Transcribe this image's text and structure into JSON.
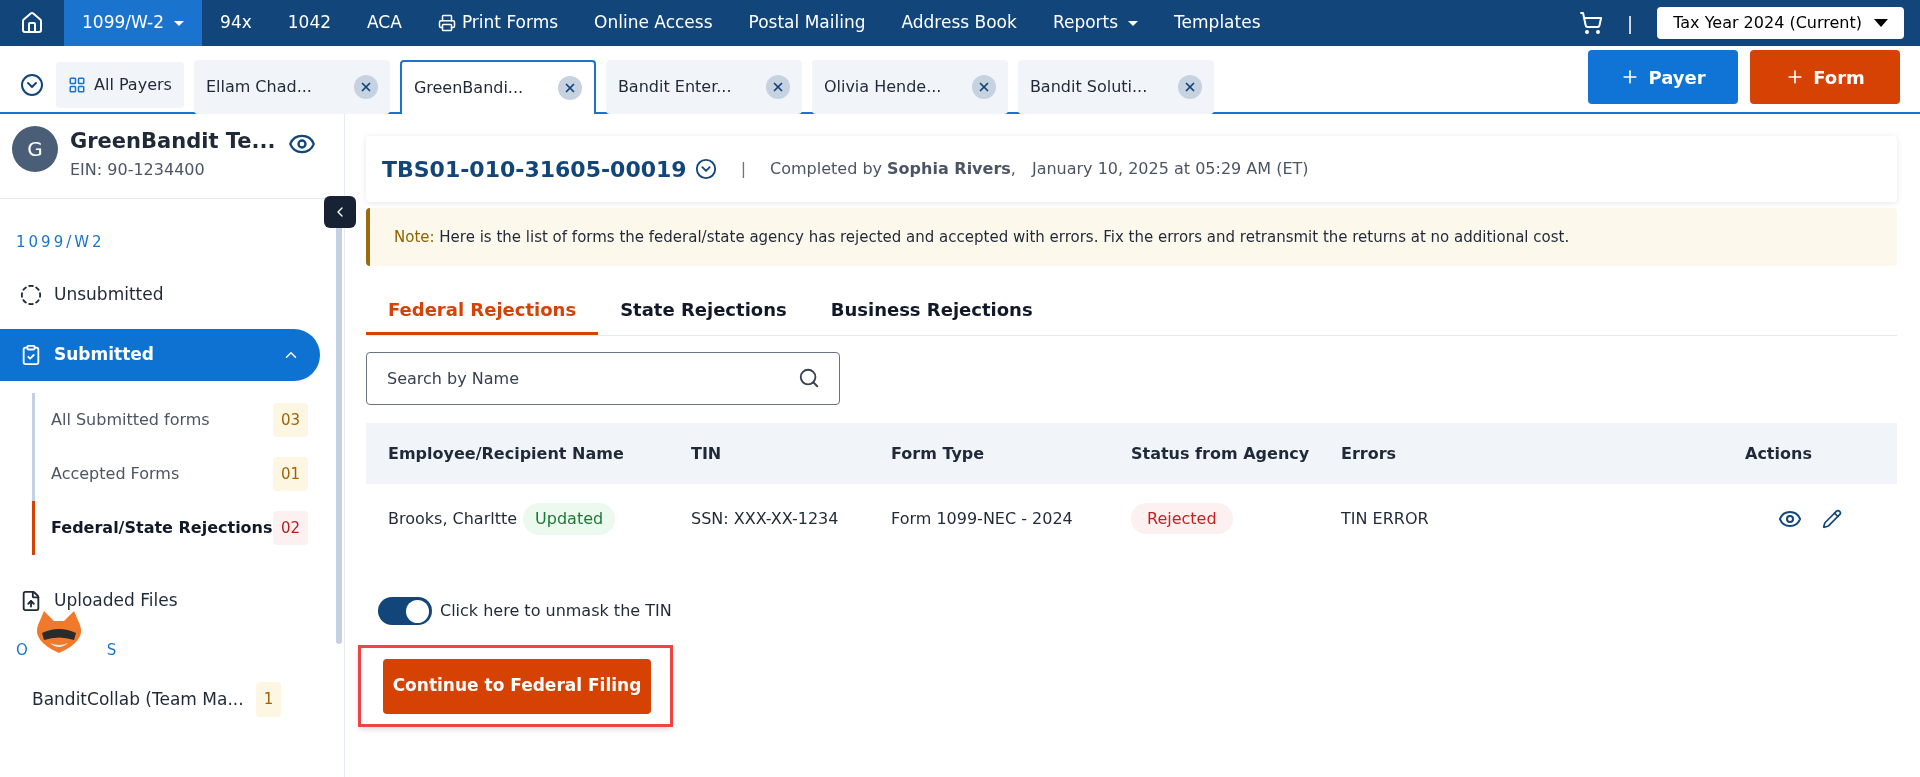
{
  "top_nav": [
    {
      "label": "1099/W-2",
      "selected": true,
      "kind": "dropdown"
    },
    {
      "label": "94x",
      "selected": false,
      "kind": "link"
    },
    {
      "label": "1042",
      "selected": false,
      "kind": "link"
    },
    {
      "label": "ACA",
      "selected": false,
      "kind": "link"
    },
    {
      "label": "Print Forms",
      "selected": false,
      "kind": "print"
    },
    {
      "label": "Online Access",
      "selected": false,
      "kind": "link"
    },
    {
      "label": "Postal Mailing",
      "selected": false,
      "kind": "link"
    },
    {
      "label": "Address Book",
      "selected": false,
      "kind": "link"
    },
    {
      "label": "Reports",
      "selected": false,
      "kind": "dropdown"
    },
    {
      "label": "Templates",
      "selected": false,
      "kind": "link"
    }
  ],
  "separator": "|",
  "tax_year": "Tax Year 2024 (Current)",
  "all_payers": "All Payers",
  "payer_tabs": [
    {
      "label": "Ellam Chad...",
      "selected": false
    },
    {
      "label": "GreenBandi...",
      "selected": true
    },
    {
      "label": "Bandit Enter...",
      "selected": false
    },
    {
      "label": "Olivia Hende...",
      "selected": false
    },
    {
      "label": "Bandit Soluti...",
      "selected": false
    }
  ],
  "add_buttons": [
    "Payer",
    "Form"
  ],
  "payer": {
    "initial": "G",
    "name": "GreenBandit Te...",
    "ein": "EIN: 90-1234400"
  },
  "sidebar": {
    "section": "1099/W2",
    "items": [
      {
        "label": "Unsubmitted",
        "kind": "pending",
        "selected": false
      },
      {
        "label": "Submitted",
        "kind": "submitted",
        "expanded": true,
        "selected": true,
        "children": [
          {
            "label": "All Submitted forms",
            "count": "03",
            "kind": "neutral",
            "selected": false
          },
          {
            "label": "Accepted Forms",
            "count": "01",
            "kind": "neutral",
            "selected": false
          },
          {
            "label": "Federal/State Rejections",
            "count": "02",
            "kind": "alert",
            "selected": true
          }
        ]
      },
      {
        "label": "Uploaded Files",
        "kind": "upload",
        "selected": false
      }
    ],
    "others_heading_parts": [
      "O",
      "S"
    ],
    "others": [
      {
        "label": "BanditCollab (Team Ma...",
        "count": "1"
      }
    ]
  },
  "submission": {
    "id": "TBS01-010-31605-00019",
    "separator": "|",
    "completed_by": "Completed by **Sophia Rivers**,",
    "date": "January 10, 2025 at 05:29 AM (ET)"
  },
  "note": {
    "label": "Note:",
    "text": "Here is the list of forms the federal/state agency has rejected and accepted with errors. Fix the errors and retransmit the returns at no additional cost."
  },
  "tabs": [
    {
      "label": "Federal Rejections",
      "selected": true
    },
    {
      "label": "State Rejections",
      "selected": false
    },
    {
      "label": "Business Rejections",
      "selected": false
    }
  ],
  "search": {
    "placeholder": "Search by Name"
  },
  "table": {
    "columns": [
      "Employee/Recipient Name",
      "TIN",
      "Form Type",
      "Status from Agency",
      "Errors",
      "Actions"
    ],
    "rows": [
      {
        "name": "Brooks, Charltte",
        "tag": "Updated",
        "tin": "SSN: XXX-XX-1234",
        "form_type": "Form 1099-NEC - 2024",
        "status": "Rejected",
        "errors": "TIN ERROR"
      }
    ]
  },
  "unmask_toggle": {
    "label": "Click here to unmask the TIN",
    "on": true
  },
  "continue_button": "Continue to Federal Filing"
}
